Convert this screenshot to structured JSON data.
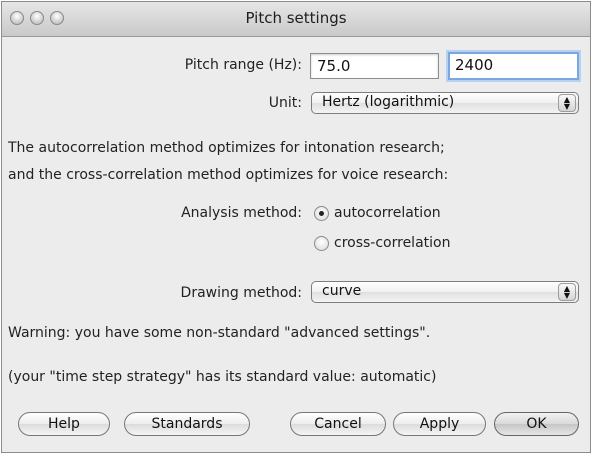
{
  "window": {
    "title": "Pitch settings"
  },
  "pitch_range": {
    "label": "Pitch range (Hz):",
    "min": "75.0",
    "max": "2400"
  },
  "unit": {
    "label": "Unit:",
    "value": "Hertz (logarithmic)"
  },
  "info": {
    "line1": "The autocorrelation method optimizes for intonation research;",
    "line2": "and the cross-correlation method optimizes for voice research:"
  },
  "analysis": {
    "label": "Analysis method:",
    "options": [
      {
        "label": "autocorrelation",
        "selected": true
      },
      {
        "label": "cross-correlation",
        "selected": false
      }
    ]
  },
  "drawing": {
    "label": "Drawing method:",
    "value": "curve"
  },
  "warnings": {
    "line1": "Warning: you have some non-standard \"advanced settings\".",
    "line2": "(your \"time step strategy\" has its standard value: automatic)"
  },
  "buttons": {
    "help": "Help",
    "standards": "Standards",
    "cancel": "Cancel",
    "apply": "Apply",
    "ok": "OK"
  }
}
